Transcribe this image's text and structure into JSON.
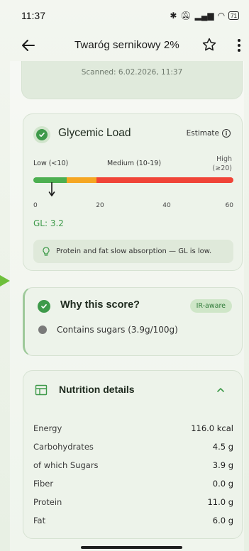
{
  "status": {
    "time": "11:37",
    "icons": "bluetooth mute signal wifi",
    "battery": "71"
  },
  "appbar": {
    "title": "Twaróg sernikowy 2%"
  },
  "scan": {
    "scanned_text": "Scanned: 6.02.2026, 11:37"
  },
  "glycemic": {
    "title": "Glycemic Load",
    "estimate_label": "Estimate",
    "low_label": "Low (<10)",
    "medium_label": "Medium (10-19)",
    "high_label_1": "High",
    "high_label_2": "(≥20)",
    "ticks": [
      "0",
      "20",
      "40",
      "60"
    ],
    "scale_max": 60,
    "value": 3.2,
    "value_label": "GL: 3.2",
    "note": "Protein and fat slow absorption — GL is low."
  },
  "why": {
    "title": "Why this score?",
    "badge": "IR-aware",
    "items": [
      {
        "text": "Contains sugars (3.9g/100g)"
      }
    ]
  },
  "nutrition": {
    "title": "Nutrition details",
    "rows": [
      {
        "label": "Energy",
        "value": "116.0 kcal"
      },
      {
        "label": "Carbohydrates",
        "value": "4.5 g"
      },
      {
        "label": "of which Sugars",
        "value": "3.9 g"
      },
      {
        "label": "Fiber",
        "value": "0.0 g"
      },
      {
        "label": "Protein",
        "value": "11.0 g"
      },
      {
        "label": "Fat",
        "value": "6.0 g"
      }
    ]
  },
  "colors": {
    "accent": "#3e9a4a",
    "low": "#4caf50",
    "medium": "#f5a623",
    "high": "#f04438"
  }
}
